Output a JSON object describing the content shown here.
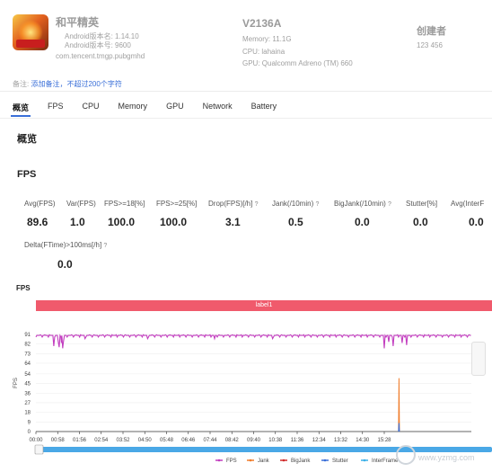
{
  "app": {
    "name": "和平精英",
    "version_name": "Android版本名: 1.14.10",
    "version_code": "Android版本号: 9600",
    "package": "com.tencent.tmgp.pubgmhd"
  },
  "device": {
    "name": "V2136A",
    "memory": "Memory: 11.1G",
    "cpu": "CPU: lahaina",
    "gpu": "GPU: Qualcomm Adreno (TM) 660"
  },
  "creator": {
    "label": "创建者",
    "id": "123 456"
  },
  "note": {
    "label": "备注:",
    "link": "添加备注，不超过200个字符"
  },
  "tabs": [
    {
      "label": "概览",
      "active": true
    },
    {
      "label": "FPS"
    },
    {
      "label": "CPU"
    },
    {
      "label": "Memory"
    },
    {
      "label": "GPU"
    },
    {
      "label": "Network"
    },
    {
      "label": "Battery"
    }
  ],
  "section_title": "概览",
  "fps_section_title": "FPS",
  "metrics": [
    {
      "label": "Avg(FPS)",
      "value": "89.6"
    },
    {
      "label": "Var(FPS)",
      "value": "1.0"
    },
    {
      "label": "FPS>=18[%]",
      "value": "100.0"
    },
    {
      "label": "FPS>=25[%]",
      "value": "100.0"
    },
    {
      "label": "Drop(FPS)[/h]",
      "value": "3.1",
      "help": "?"
    },
    {
      "label": "Jank(/10min)",
      "value": "0.5",
      "help": "?"
    },
    {
      "label": "BigJank(/10min)",
      "value": "0.0",
      "help": "?"
    },
    {
      "label": "Stutter[%]",
      "value": "0.0"
    },
    {
      "label": "Avg(InterF",
      "value": "0.0"
    }
  ],
  "metric_row2": {
    "label": "Delta(FTime)>100ms[/h]",
    "help": "?",
    "value": "0.0"
  },
  "chart_data": {
    "type": "line",
    "title": "FPS",
    "band_label": "label1",
    "ylabel": "FPS",
    "y_ticks": [
      0,
      9,
      18,
      27,
      36,
      45,
      54,
      64,
      73,
      82,
      91
    ],
    "ylim": [
      0,
      96
    ],
    "x_ticks": [
      "00:00",
      "00:58",
      "01:56",
      "02:54",
      "03:52",
      "04:50",
      "05:48",
      "06:46",
      "07:44",
      "08:42",
      "09:40",
      "10:38",
      "11:36",
      "12:34",
      "13:32",
      "14:30",
      "15:28"
    ],
    "xlim_seconds": [
      0,
      975
    ],
    "grid": true,
    "legend_position": "bottom",
    "series": [
      {
        "name": "FPS",
        "color": "#c23dbf",
        "baseline": 90,
        "dips": [
          [
            40,
            80
          ],
          [
            50,
            84
          ],
          [
            52,
            79
          ],
          [
            57,
            83
          ],
          [
            60,
            78
          ],
          [
            62,
            85
          ],
          [
            110,
            87
          ],
          [
            250,
            87
          ],
          [
            400,
            87
          ],
          [
            530,
            87
          ],
          [
            780,
            78
          ],
          [
            790,
            84
          ],
          [
            800,
            80
          ],
          [
            820,
            83
          ],
          [
            830,
            81
          ]
        ]
      },
      {
        "name": "Jank",
        "color": "#f07c2a",
        "points": [
          [
            812,
            0
          ],
          [
            813,
            50
          ],
          [
            814,
            0
          ]
        ]
      },
      {
        "name": "BigJank",
        "color": "#d12b2b",
        "points": []
      },
      {
        "name": "Stutter",
        "color": "#3a6fd8",
        "points": [
          [
            812,
            0
          ],
          [
            813,
            8
          ],
          [
            814,
            0
          ]
        ]
      },
      {
        "name": "InterFrame",
        "color": "#3ab0e8",
        "points": []
      }
    ]
  },
  "watermark": "www.yzmg.com"
}
